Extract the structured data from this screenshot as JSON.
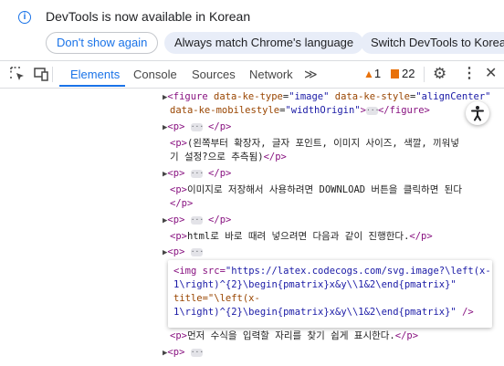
{
  "infobar": {
    "message": "DevTools is now available in Korean",
    "buttons": [
      "Don't show again",
      "Always match Chrome's language",
      "Switch DevTools to Korean"
    ]
  },
  "toolbar": {
    "tabs": [
      "Elements",
      "Console",
      "Sources",
      "Network"
    ],
    "more": "≫",
    "warnings": "1",
    "issues": "22"
  },
  "code": {
    "l1_open": "<figure ",
    "l1_a1": "data-ke-type",
    "l1_v1": "\"image\"",
    "l1_a2": "data-ke-style",
    "l1_v2": "\"alignCenter\"",
    "l2_a": "data-ke-mobilestyle",
    "l2_v": "\"widthOrigin\"",
    "l2_close": "</figure>",
    "p_open": "<p>",
    "p_close": "</p>",
    "t1a": "(왼쪽부터 확장자, 글자 포인트, 이미지 사이즈, 색깔, 끼워넣",
    "t1b": "기 설정?으로 추측됨)",
    "t2": "이미지로 저장해서 사용하려면 DOWNLOAD 버튼을 클릭하면 된다",
    "t3": "html로 바로 때려 넣으려면 다음과 같이 진행한다.",
    "t4": "먼저 수식을 입력할 자리를 찾기 쉽게 표시한다."
  },
  "tooltip": {
    "l1a": "<img src=",
    "l1b": "\"https://latex.codecogs.com/svg.image?\\left(x-",
    "l2": "1\\right)^{2}\\begin{pmatrix}x&y\\\\1&2\\end{pmatrix}\"",
    "l3": "title=\"\\left(x-",
    "l4a": "1\\right)^{2}\\begin{pmatrix}x&y\\\\1&2\\end{pmatrix}\"",
    "l4b": "/>"
  }
}
